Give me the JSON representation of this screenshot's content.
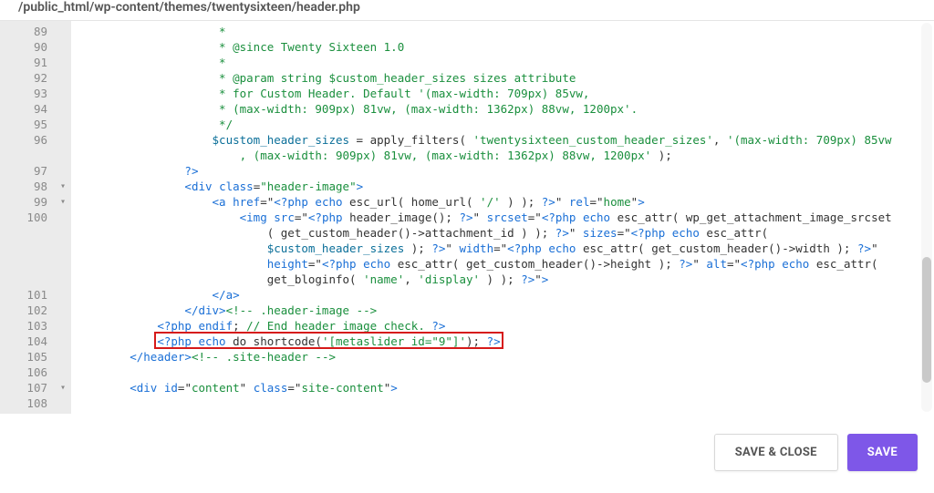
{
  "file_path": "/public_html/wp-content/themes/twentysixteen/header.php",
  "buttons": {
    "save_close": "SAVE & CLOSE",
    "save": "SAVE"
  },
  "highlight_line_number": 104,
  "lines": [
    {
      "num": 89,
      "indent": "                    ",
      "segs": [
        {
          "t": " *",
          "cls": "c-comment"
        }
      ]
    },
    {
      "num": 90,
      "indent": "                    ",
      "segs": [
        {
          "t": " * @since Twenty Sixteen 1.0",
          "cls": "c-comment"
        }
      ]
    },
    {
      "num": 91,
      "indent": "                    ",
      "segs": [
        {
          "t": " *",
          "cls": "c-comment"
        }
      ]
    },
    {
      "num": 92,
      "indent": "                    ",
      "segs": [
        {
          "t": " * @param string $custom_header_sizes sizes attribute",
          "cls": "c-comment"
        }
      ]
    },
    {
      "num": 93,
      "indent": "                    ",
      "segs": [
        {
          "t": " * for Custom Header. Default '(max-width: 709px) 85vw,",
          "cls": "c-comment"
        }
      ]
    },
    {
      "num": 94,
      "indent": "                    ",
      "segs": [
        {
          "t": " * (max-width: 909px) 81vw, (max-width: 1362px) 88vw, 1200px'.",
          "cls": "c-comment"
        }
      ]
    },
    {
      "num": 95,
      "indent": "                    ",
      "segs": [
        {
          "t": " */",
          "cls": "c-comment"
        }
      ]
    },
    {
      "num": 96,
      "indent": "                    ",
      "segs": [
        {
          "t": "$custom_header_sizes",
          "cls": "c-var"
        },
        {
          "t": " = apply_filters( "
        },
        {
          "t": "'twentysixteen_custom_header_sizes'",
          "cls": "c-str"
        },
        {
          "t": ", "
        },
        {
          "t": "'(max-width: 709px) 85vw",
          "cls": "c-str"
        }
      ]
    },
    {
      "num": 0,
      "indent": "                        ",
      "segs": [
        {
          "t": ", (max-width: 909px) 81vw, (max-width: 1362px) 88vw, 1200px'",
          "cls": "c-str"
        },
        {
          "t": " );"
        }
      ]
    },
    {
      "num": 97,
      "indent": "                ",
      "segs": [
        {
          "t": "?>",
          "cls": "c-tag"
        }
      ]
    },
    {
      "num": 98,
      "fold": "▾",
      "indent": "                ",
      "segs": [
        {
          "t": "<div ",
          "cls": "c-tag"
        },
        {
          "t": "class",
          "cls": "c-attr"
        },
        {
          "t": "=",
          "cls": ""
        },
        {
          "t": "\"header-image\"",
          "cls": "c-str"
        },
        {
          "t": ">",
          "cls": "c-tag"
        }
      ]
    },
    {
      "num": 99,
      "fold": "▾",
      "indent": "                    ",
      "segs": [
        {
          "t": "<a ",
          "cls": "c-tag"
        },
        {
          "t": "href",
          "cls": "c-attr"
        },
        {
          "t": "=\""
        },
        {
          "t": "<?php ",
          "cls": "c-tag"
        },
        {
          "t": "echo",
          "cls": "c-key"
        },
        {
          "t": " esc_url( home_url( "
        },
        {
          "t": "'/'",
          "cls": "c-str"
        },
        {
          "t": " ) ); "
        },
        {
          "t": "?>",
          "cls": "c-tag"
        },
        {
          "t": "\" "
        },
        {
          "t": "rel",
          "cls": "c-attr"
        },
        {
          "t": "=\""
        },
        {
          "t": "home",
          "cls": "c-str"
        },
        {
          "t": "\""
        },
        {
          "t": ">",
          "cls": "c-tag"
        }
      ]
    },
    {
      "num": 100,
      "indent": "                        ",
      "segs": [
        {
          "t": "<img ",
          "cls": "c-tag"
        },
        {
          "t": "src",
          "cls": "c-attr"
        },
        {
          "t": "=\""
        },
        {
          "t": "<?php ",
          "cls": "c-tag"
        },
        {
          "t": "header_image(); "
        },
        {
          "t": "?>",
          "cls": "c-tag"
        },
        {
          "t": "\" "
        },
        {
          "t": "srcset",
          "cls": "c-attr"
        },
        {
          "t": "=\""
        },
        {
          "t": "<?php ",
          "cls": "c-tag"
        },
        {
          "t": "echo",
          "cls": "c-key"
        },
        {
          "t": " esc_attr( wp_get_attachment_image_srcset"
        }
      ]
    },
    {
      "num": 0,
      "indent": "                            ",
      "segs": [
        {
          "t": "( get_custom_header()->attachment_id ) ); "
        },
        {
          "t": "?>",
          "cls": "c-tag"
        },
        {
          "t": "\" "
        },
        {
          "t": "sizes",
          "cls": "c-attr"
        },
        {
          "t": "=\""
        },
        {
          "t": "<?php ",
          "cls": "c-tag"
        },
        {
          "t": "echo",
          "cls": "c-key"
        },
        {
          "t": " esc_attr( "
        }
      ]
    },
    {
      "num": 0,
      "indent": "                            ",
      "segs": [
        {
          "t": "$custom_header_sizes",
          "cls": "c-var"
        },
        {
          "t": " ); "
        },
        {
          "t": "?>",
          "cls": "c-tag"
        },
        {
          "t": "\" "
        },
        {
          "t": "width",
          "cls": "c-attr"
        },
        {
          "t": "=\""
        },
        {
          "t": "<?php ",
          "cls": "c-tag"
        },
        {
          "t": "echo",
          "cls": "c-key"
        },
        {
          "t": " esc_attr( get_custom_header()->width ); "
        },
        {
          "t": "?>",
          "cls": "c-tag"
        },
        {
          "t": "\""
        }
      ]
    },
    {
      "num": 0,
      "indent": "                            ",
      "segs": [
        {
          "t": "height",
          "cls": "c-attr"
        },
        {
          "t": "=\""
        },
        {
          "t": "<?php ",
          "cls": "c-tag"
        },
        {
          "t": "echo",
          "cls": "c-key"
        },
        {
          "t": " esc_attr( get_custom_header()->height ); "
        },
        {
          "t": "?>",
          "cls": "c-tag"
        },
        {
          "t": "\" "
        },
        {
          "t": "alt",
          "cls": "c-attr"
        },
        {
          "t": "=\""
        },
        {
          "t": "<?php ",
          "cls": "c-tag"
        },
        {
          "t": "echo",
          "cls": "c-key"
        },
        {
          "t": " esc_attr( "
        }
      ]
    },
    {
      "num": 0,
      "indent": "                            ",
      "segs": [
        {
          "t": "get_bloginfo( "
        },
        {
          "t": "'name'",
          "cls": "c-str"
        },
        {
          "t": ", "
        },
        {
          "t": "'display'",
          "cls": "c-str"
        },
        {
          "t": " ) ); "
        },
        {
          "t": "?>",
          "cls": "c-tag"
        },
        {
          "t": "\""
        },
        {
          "t": ">",
          "cls": "c-tag"
        }
      ]
    },
    {
      "num": 101,
      "indent": "                    ",
      "segs": [
        {
          "t": "</a>",
          "cls": "c-tag"
        }
      ]
    },
    {
      "num": 102,
      "indent": "                ",
      "segs": [
        {
          "t": "</div>",
          "cls": "c-tag"
        },
        {
          "t": "<!-- .header-image -->",
          "cls": "c-comment"
        }
      ]
    },
    {
      "num": 103,
      "indent": "            ",
      "segs": [
        {
          "t": "<?php ",
          "cls": "c-tag"
        },
        {
          "t": "endif",
          "cls": "c-key"
        },
        {
          "t": "; "
        },
        {
          "t": "// End header image check. ",
          "cls": "c-comment"
        },
        {
          "t": "?>",
          "cls": "c-tag"
        }
      ]
    },
    {
      "num": 104,
      "indent": "            ",
      "segs": [
        {
          "t": "<?php ",
          "cls": "c-tag"
        },
        {
          "t": "echo",
          "cls": "c-key"
        },
        {
          "t": " do_shortcode("
        },
        {
          "t": "'[metaslider id=\"9\"]'",
          "cls": "c-str"
        },
        {
          "t": "); "
        },
        {
          "t": "?>",
          "cls": "c-tag"
        }
      ]
    },
    {
      "num": 105,
      "indent": "        ",
      "segs": [
        {
          "t": "</header>",
          "cls": "c-tag"
        },
        {
          "t": "<!-- .site-header -->",
          "cls": "c-comment"
        }
      ]
    },
    {
      "num": 106,
      "indent": "",
      "segs": []
    },
    {
      "num": 107,
      "fold": "▾",
      "indent": "        ",
      "segs": [
        {
          "t": "<div ",
          "cls": "c-tag"
        },
        {
          "t": "id",
          "cls": "c-attr"
        },
        {
          "t": "=\""
        },
        {
          "t": "content",
          "cls": "c-str"
        },
        {
          "t": "\" "
        },
        {
          "t": "class",
          "cls": "c-attr"
        },
        {
          "t": "=\""
        },
        {
          "t": "site-content",
          "cls": "c-str"
        },
        {
          "t": "\""
        },
        {
          "t": ">",
          "cls": "c-tag"
        }
      ]
    },
    {
      "num": 108,
      "indent": "",
      "segs": []
    }
  ]
}
